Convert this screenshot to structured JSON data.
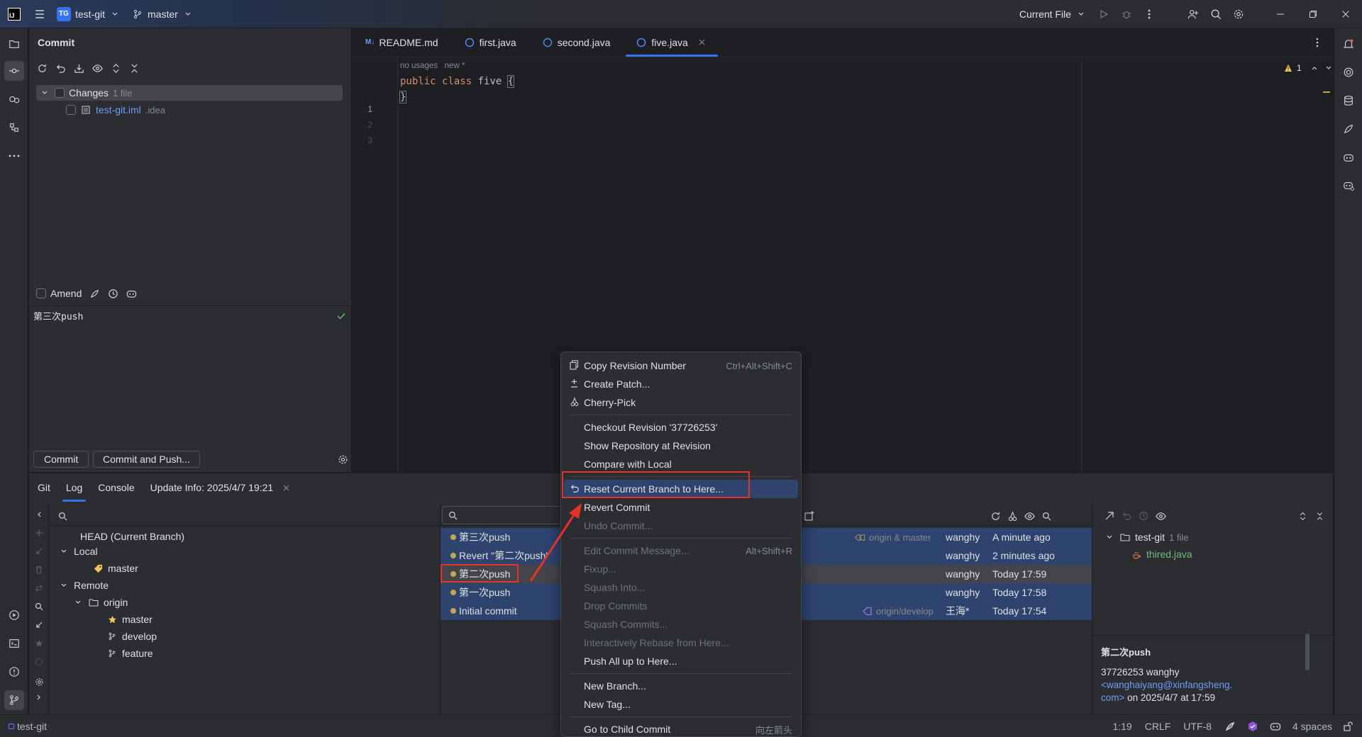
{
  "titlebar": {
    "project_badge": "TG",
    "project": "test-git",
    "branch": "master",
    "run_config": "Current File"
  },
  "commit_panel": {
    "title": "Commit",
    "changes_label": "Changes",
    "changes_count": "1 file",
    "file_name": "test-git.iml",
    "file_dir": ".idea",
    "amend_label": "Amend",
    "message": "第三次push",
    "commit_button": "Commit",
    "commit_push_button": "Commit and Push..."
  },
  "editor": {
    "tabs": [
      {
        "label": "README.md",
        "icon": "M↓"
      },
      {
        "label": "first.java"
      },
      {
        "label": "second.java"
      },
      {
        "label": "five.java"
      }
    ],
    "inlay": "no usages   new *",
    "line_numbers": [
      "1",
      "2",
      "3"
    ],
    "code": {
      "kw1": "public",
      "kw2": "class",
      "name": "five",
      "open": "{",
      "close": "}"
    },
    "warning_count": "1"
  },
  "bottom": {
    "tabs": [
      "Git",
      "Log",
      "Console",
      "Update Info: 2025/4/7 19:21"
    ],
    "branches": {
      "head": "HEAD (Current Branch)",
      "local": "Local",
      "local_master": "master",
      "remote": "Remote",
      "origin": "origin",
      "remote_branches": [
        "master",
        "develop",
        "feature"
      ]
    },
    "log": [
      {
        "message": "第三次push",
        "refs": "origin & master",
        "author": "wanghy",
        "date": "A minute ago"
      },
      {
        "message": "Revert \"第二次push\"",
        "refs": "",
        "author": "wanghy",
        "date": "2 minutes ago"
      },
      {
        "message": "第二次push",
        "refs": "",
        "author": "wanghy",
        "date": "Today 17:59"
      },
      {
        "message": "第一次push",
        "refs": "",
        "author": "wanghy",
        "date": "Today 17:58"
      },
      {
        "message": "Initial commit",
        "refs": "origin/develop",
        "author": "王海*",
        "date": "Today 17:54"
      }
    ],
    "details": {
      "project": "test-git",
      "count": "1 file",
      "file": "thired.java",
      "commit_title": "第二次push",
      "hash_author": "37726253 wanghy",
      "email": "<wanghaiyang@xinfangsheng.",
      "email_cont": "com>",
      "date": "on 2025/4/7 at 17:59"
    }
  },
  "menu": {
    "items": [
      {
        "label": "Copy Revision Number",
        "shortcut": "Ctrl+Alt+Shift+C"
      },
      {
        "label": "Create Patch..."
      },
      {
        "label": "Cherry-Pick"
      },
      {
        "label": "Checkout Revision '37726253'"
      },
      {
        "label": "Show Repository at Revision"
      },
      {
        "label": "Compare with Local"
      },
      {
        "label": "Reset Current Branch to Here..."
      },
      {
        "label": "Revert Commit"
      },
      {
        "label": "Undo Commit..."
      },
      {
        "label": "Edit Commit Message...",
        "shortcut": "Alt+Shift+R"
      },
      {
        "label": "Fixup..."
      },
      {
        "label": "Squash Into..."
      },
      {
        "label": "Drop Commits"
      },
      {
        "label": "Squash Commits..."
      },
      {
        "label": "Interactively Rebase from Here..."
      },
      {
        "label": "Push All up to Here..."
      },
      {
        "label": "New Branch..."
      },
      {
        "label": "New Tag..."
      },
      {
        "label": "Go to Child Commit",
        "shortcut": "向左箭头"
      }
    ]
  },
  "statusbar": {
    "project": "test-git",
    "position": "1:19",
    "line_sep": "CRLF",
    "encoding": "UTF-8",
    "indent": "4 spaces"
  },
  "colors": {
    "accent": "#3574f0",
    "selection": "#2e436e",
    "annotation": "#e5322d",
    "graph": "#c4a652"
  }
}
